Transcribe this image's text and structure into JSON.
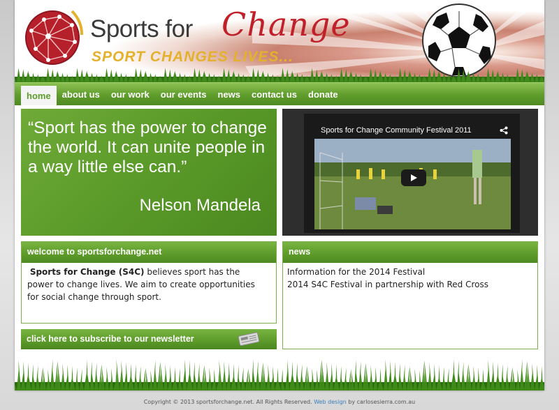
{
  "header": {
    "logo_text_sports": "Sports for",
    "logo_text_change": "Change",
    "tagline": "SPORT CHANGES LIVES...",
    "logo_icon": "globe-network-icon",
    "ball_icon": "soccer-ball-icon"
  },
  "nav": {
    "items": [
      {
        "label": "home",
        "active": true
      },
      {
        "label": "about us"
      },
      {
        "label": "our work"
      },
      {
        "label": "our events"
      },
      {
        "label": "news"
      },
      {
        "label": "contact us"
      },
      {
        "label": "donate"
      }
    ]
  },
  "quote": {
    "text": "“Sport has the power to change the world.  It can unite people in a way little else can.”",
    "author": "Nelson Mandela"
  },
  "video": {
    "title": "Sports for Change Community Festival 2011",
    "share_icon": "share-icon",
    "play_icon": "play-icon"
  },
  "welcome": {
    "heading": "welcome to sportsforchange.net",
    "org_name": "Sports for Change (S4C)",
    "body": " believes sport has the power to change  lives.   We aim to create opportunities for social change through sport."
  },
  "news": {
    "heading": "news",
    "items": [
      "Information for the 2014 Festival",
      "2014 S4C Festival in partnership with Red Cross"
    ]
  },
  "newsletter": {
    "label": "click here to subscribe to our newsletter",
    "icon": "newspaper-icon"
  },
  "footer": {
    "copyright": "Copyright © 2013 sportsforchange.net. All Rights Reserved.",
    "link_label": "Web design",
    "credit": " by carlosesierra.com.au"
  },
  "colors": {
    "brand_green": "#5e9c2b",
    "brand_red": "#c0202a",
    "tagline_gold": "#e3b12b"
  }
}
